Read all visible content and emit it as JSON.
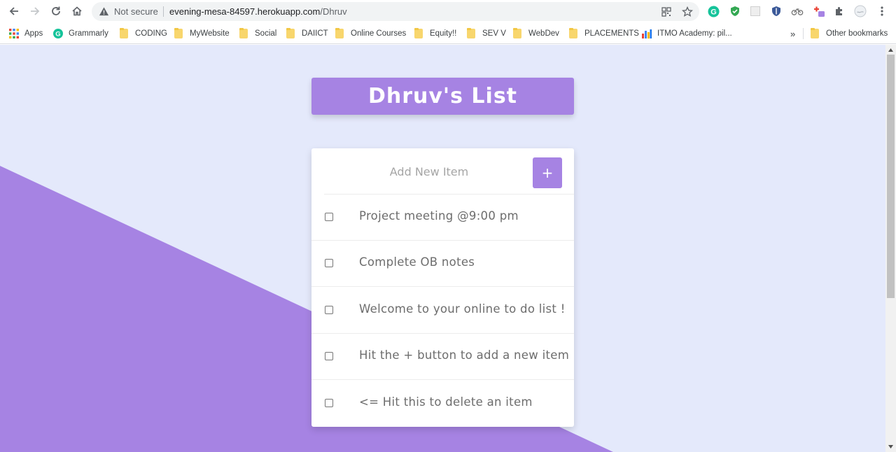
{
  "browser": {
    "security_label": "Not secure",
    "url_domain": "evening-mesa-84597.herokuapp.com",
    "url_path": "/Dhruv",
    "bookmarks": [
      {
        "label": "Apps",
        "icon": "apps-grid-icon"
      },
      {
        "label": "Grammarly",
        "icon": "grammarly-icon"
      },
      {
        "label": "CODING",
        "icon": "folder-icon"
      },
      {
        "label": "MyWebsite",
        "icon": "folder-icon"
      },
      {
        "label": "Social",
        "icon": "folder-icon"
      },
      {
        "label": "DAIICT",
        "icon": "folder-icon"
      },
      {
        "label": "Online Courses",
        "icon": "folder-icon"
      },
      {
        "label": "Equity!!",
        "icon": "folder-icon"
      },
      {
        "label": "SEV V",
        "icon": "folder-icon"
      },
      {
        "label": "WebDev",
        "icon": "folder-icon"
      },
      {
        "label": "PLACEMENTS",
        "icon": "folder-icon"
      },
      {
        "label": "ITMO Academy: pil...",
        "icon": "bar-chart-icon"
      }
    ],
    "more_bookmarks": "»",
    "other_bookmarks": "Other bookmarks"
  },
  "app": {
    "title": "Dhruv's List",
    "new_item_placeholder": "Add New Item",
    "add_button_label": "+",
    "items": [
      {
        "text": "Project meeting @9:00 pm",
        "checked": false
      },
      {
        "text": "Complete OB notes",
        "checked": false
      },
      {
        "text": "Welcome to your online to do list !",
        "checked": false
      },
      {
        "text": "Hit the + button to add a new item",
        "checked": false
      },
      {
        "text": "<= Hit this to delete an item",
        "checked": false
      }
    ]
  },
  "colors": {
    "accent": "#a683e3",
    "page_background": "#e4e9fb",
    "card_background": "#ffffff"
  }
}
